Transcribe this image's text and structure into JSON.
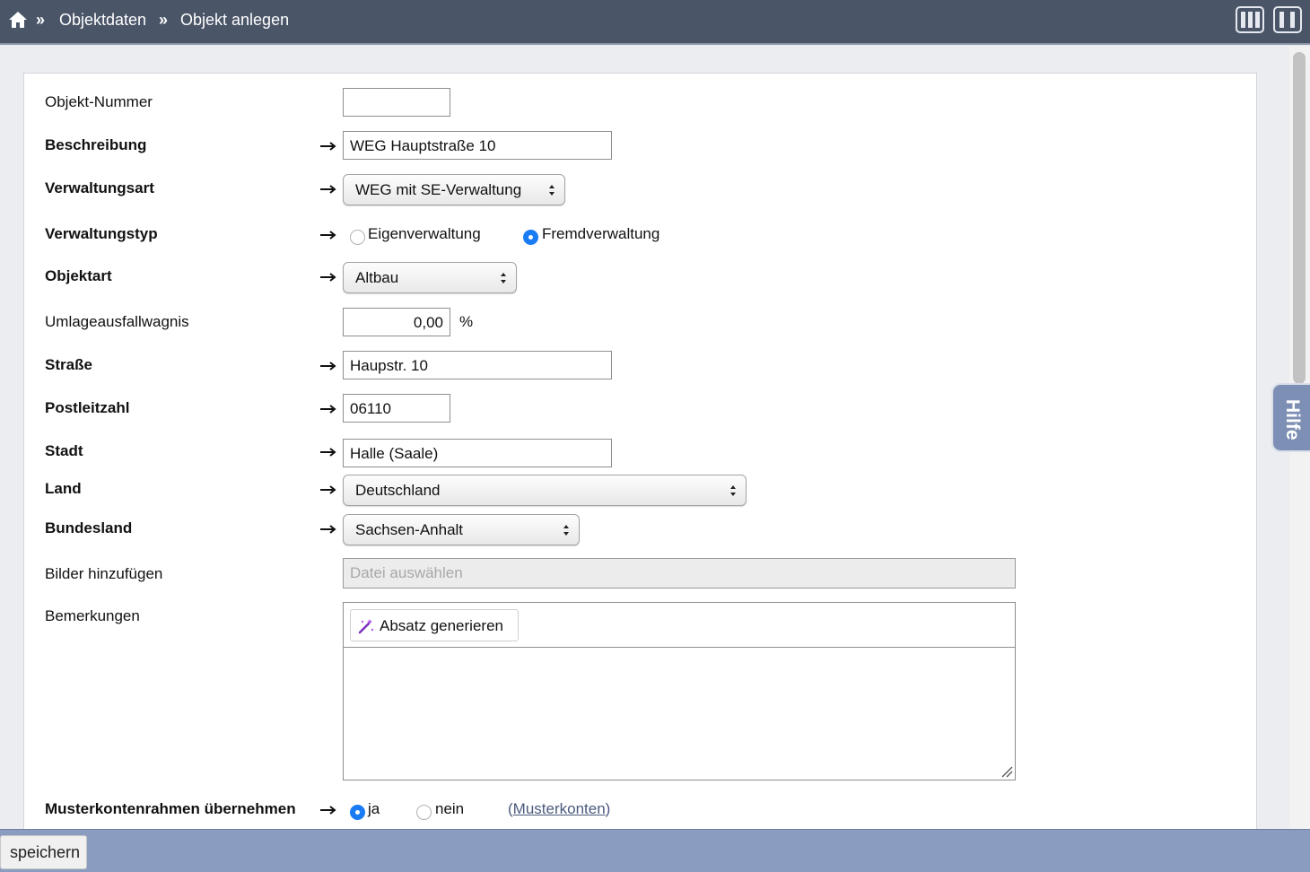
{
  "breadcrumb": {
    "items": [
      "Objektdaten",
      "Objekt anlegen"
    ],
    "separator": "»"
  },
  "form": {
    "objekt_nummer": {
      "label": "Objekt-Nummer",
      "value": ""
    },
    "beschreibung": {
      "label": "Beschreibung",
      "value": "WEG Hauptstraße 10"
    },
    "verwaltungsart": {
      "label": "Verwaltungsart",
      "value": "WEG mit SE-Verwaltung"
    },
    "verwaltungstyp": {
      "label": "Verwaltungstyp",
      "options": [
        "Eigenverwaltung",
        "Fremdverwaltung"
      ],
      "selected": "Fremdverwaltung"
    },
    "objektart": {
      "label": "Objektart",
      "value": "Altbau"
    },
    "umlageausfallwagnis": {
      "label": "Umlageausfallwagnis",
      "value": "0,00",
      "unit": "%"
    },
    "strasse": {
      "label": "Straße",
      "value": "Haupstr. 10"
    },
    "postleitzahl": {
      "label": "Postleitzahl",
      "value": "06110"
    },
    "stadt": {
      "label": "Stadt",
      "value": "Halle (Saale)"
    },
    "land": {
      "label": "Land",
      "value": "Deutschland"
    },
    "bundesland": {
      "label": "Bundesland",
      "value": "Sachsen-Anhalt"
    },
    "bilder": {
      "label": "Bilder hinzufügen",
      "placeholder": "Datei auswählen"
    },
    "bemerkungen": {
      "label": "Bemerkungen",
      "generate_label": "Absatz generieren",
      "value": ""
    },
    "musterkontenrahmen": {
      "label": "Musterkontenrahmen übernehmen",
      "options": [
        "ja",
        "nein"
      ],
      "selected": "ja",
      "link_open": "(",
      "link": "Musterkonten",
      "link_close": ")"
    }
  },
  "help_tab": "Hilfe",
  "footer": {
    "save_label": "speichern"
  },
  "colors": {
    "topbar": "#4a5568",
    "footer": "#8a9cbf",
    "radio_selected": "#1a7cf4"
  }
}
